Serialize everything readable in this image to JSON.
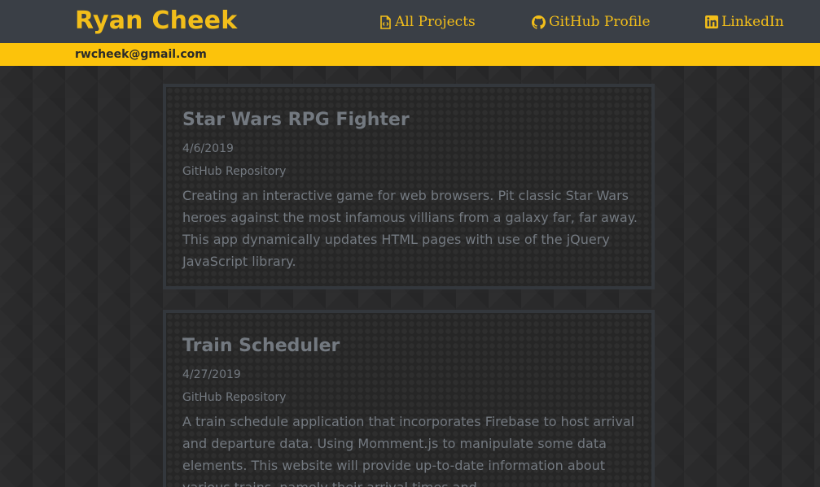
{
  "header": {
    "name": "Ryan Cheek",
    "email": "rwcheek@gmail.com",
    "nav": [
      {
        "label": "All Projects",
        "icon": "file-code-icon"
      },
      {
        "label": "GitHub Profile",
        "icon": "github-icon"
      },
      {
        "label": "LinkedIn",
        "icon": "linkedin-icon"
      }
    ]
  },
  "projects": [
    {
      "title": "Star Wars RPG Fighter",
      "date": "4/6/2019",
      "repo_label": "GitHub Repository",
      "description": "Creating an interactive game for web browsers. Pit classic Star Wars heroes against the most infamous villians from a galaxy far, far away. This app dynamically updates HTML pages with use of the jQuery JavaScript library."
    },
    {
      "title": "Train Scheduler",
      "date": "4/27/2019",
      "repo_label": "GitHub Repository",
      "description": "A train schedule application that incorporates Firebase to host arrival and departure data. Using Momment.js to manipulate some data elements. This website will provide up-to-date information about various trains, namely their arrival times and"
    }
  ],
  "colors": {
    "accent": "#f2be1a",
    "accent_bar": "#fcc30b",
    "header_bg": "#3a3f46",
    "page_bg": "#2a2a2b",
    "card_bg": "#262626",
    "card_text": "#737980"
  }
}
